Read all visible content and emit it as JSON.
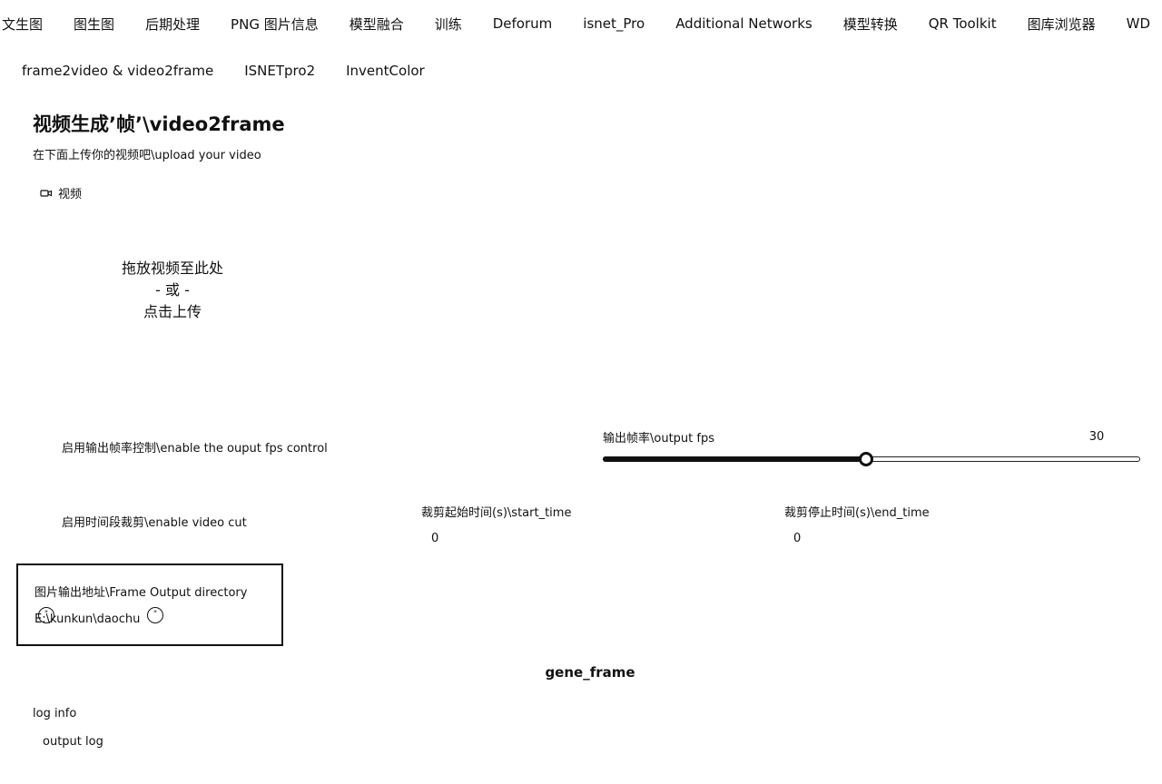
{
  "top_tabs": [
    "文生图",
    "图生图",
    "后期处理",
    "PNG 图片信息",
    "模型融合",
    "训练",
    "Deforum",
    "isnet_Pro",
    "Additional Networks",
    "模型转换",
    "QR Toolkit",
    "图库浏览器",
    "WD"
  ],
  "sub_tabs": [
    "frame2video & video2frame",
    "ISNETpro2",
    "InventColor"
  ],
  "section": {
    "title": "视频生成’帧’\\video2frame",
    "subtitle": "在下面上传你的视频吧\\upload your video"
  },
  "video_upload": {
    "label": "视频",
    "icon": "video-camera-icon",
    "drop_line1": "拖放视频至此处",
    "drop_line2": "- 或 -",
    "drop_line3": "点击上传"
  },
  "fps_control": {
    "checkbox_label": "启用输出帧率控制\\enable the ouput fps control",
    "slider_label": "输出帧率\\output fps",
    "value": "30",
    "fill_fraction": 0.49
  },
  "video_cut": {
    "checkbox_label": "启用时间段裁剪\\enable video cut",
    "start_label": "裁剪起始时间(s)\\start_time",
    "start_value": "0",
    "end_label": "裁剪停止时间(s)\\end_time",
    "end_value": "0"
  },
  "output_dir": {
    "label": "图片输出地址\\Frame Output directory",
    "value": "E:\\kunkun\\daochu"
  },
  "generate_button": "gene_frame",
  "log": {
    "label": "log info",
    "output": "output log"
  },
  "colors": {
    "text": "#111111",
    "background": "#ffffff"
  }
}
